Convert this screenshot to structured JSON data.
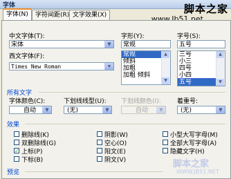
{
  "window": {
    "title": "字体"
  },
  "watermark": {
    "site": "脚本之家",
    "url": "www.Jb51.net",
    "bottom": "脚本之家",
    "bottom_url": "WWW.JB51.NET"
  },
  "tabs": [
    "字体(N)",
    "字符间距(R)",
    "文字效果(X)"
  ],
  "fonts": {
    "chinese_label": "中文字体(T):",
    "chinese_value": "宋体",
    "western_label": "西文字体(F):",
    "western_value": "Times New Roman",
    "style_label": "字形(Y):",
    "style_value": "常规",
    "style_options": [
      "常规",
      "倾斜",
      "加粗",
      "加粗 倾斜"
    ],
    "size_label": "字号(S):",
    "size_value": "五号",
    "size_options": [
      "三号",
      "小三",
      "四号",
      "小四",
      "五号"
    ]
  },
  "all_text": {
    "section_label": "所有文字",
    "font_color_label": "字体颜色(C):",
    "font_color_value": "自动",
    "underline_style_label": "下划线线型(U):",
    "underline_style_value": "(无)",
    "underline_color_label": "下划线颜色(I):",
    "underline_color_value": "自动",
    "emphasis_label": "着重号:",
    "emphasis_value": "(无)"
  },
  "effects": {
    "section_label": "效果",
    "options": [
      {
        "label": "删除线(K)",
        "checked": false
      },
      {
        "label": "双删除线(G)",
        "checked": false
      },
      {
        "label": "上标(P)",
        "checked": true
      },
      {
        "label": "下标(B)",
        "checked": false
      },
      {
        "label": "阴影(W)",
        "checked": false
      },
      {
        "label": "空心(O)",
        "checked": false
      },
      {
        "label": "阳文(E)",
        "checked": false
      },
      {
        "label": "阴文(V)",
        "checked": false
      },
      {
        "label": "小型大写字母(M)",
        "checked": false
      },
      {
        "label": "全部大写字母(A)",
        "checked": false
      },
      {
        "label": "隐藏文字(H)",
        "checked": false
      }
    ]
  },
  "preview": {
    "label": "预览"
  }
}
